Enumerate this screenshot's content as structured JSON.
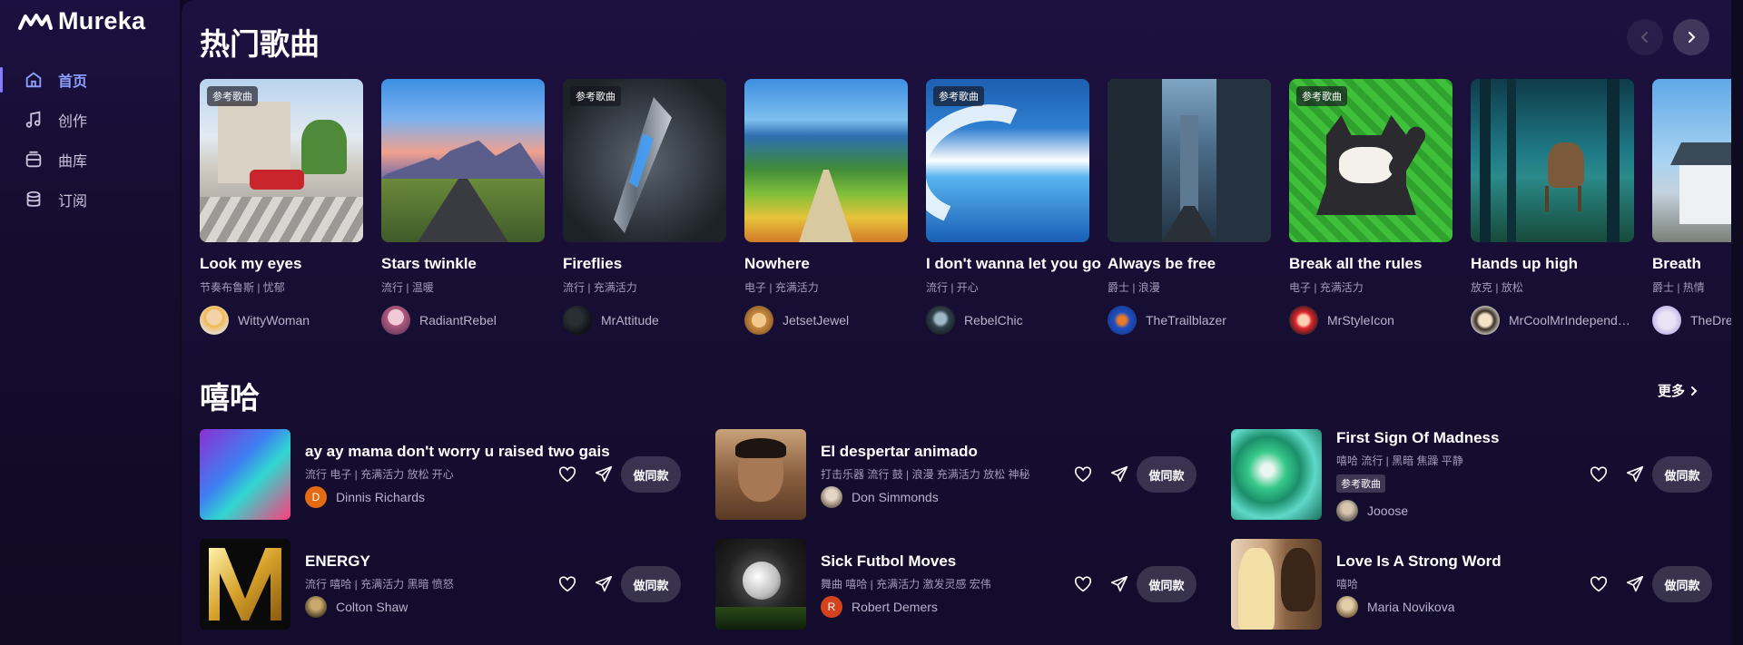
{
  "app": {
    "name": "Mureka"
  },
  "nav": [
    {
      "label": "首页",
      "icon": "home-icon",
      "active": true
    },
    {
      "label": "创作",
      "icon": "music-note-icon",
      "active": false
    },
    {
      "label": "曲库",
      "icon": "library-icon",
      "active": false
    },
    {
      "label": "订阅",
      "icon": "subscription-icon",
      "active": false
    }
  ],
  "trending": {
    "title": "热门歌曲",
    "cards": [
      {
        "title": "Look my eyes",
        "tags": "节奏布鲁斯 | 忧郁",
        "user": "WittyWoman",
        "badge": "参考歌曲",
        "art": "street-scene"
      },
      {
        "title": "Stars twinkle",
        "tags": "流行 | 温暖",
        "user": "RadiantRebel",
        "badge": "",
        "art": "mountain-road"
      },
      {
        "title": "Fireflies",
        "tags": "流行 | 充满活力",
        "user": "MrAttitude",
        "badge": "参考歌曲",
        "art": "spaceship"
      },
      {
        "title": "Nowhere",
        "tags": "电子 | 充满活力",
        "user": "JetsetJewel",
        "badge": "",
        "art": "green-valley"
      },
      {
        "title": "I don't wanna let you go",
        "tags": "流行 | 开心",
        "user": "RebelChic",
        "badge": "参考歌曲",
        "art": "great-wave"
      },
      {
        "title": "Always be free",
        "tags": "爵士 | 浪漫",
        "user": "TheTrailblazer",
        "badge": "",
        "art": "city-street"
      },
      {
        "title": "Break all the rules",
        "tags": "电子 | 充满活力",
        "user": "MrStyleIcon",
        "badge": "参考歌曲",
        "art": "pixel-cat"
      },
      {
        "title": "Hands up high",
        "tags": "放克 | 放松",
        "user": "MrCoolMrIndependent",
        "badge": "",
        "art": "forest-deer"
      },
      {
        "title": "Breath",
        "tags": "爵士 | 热情",
        "user": "TheDreamer",
        "badge": "",
        "art": "house"
      }
    ]
  },
  "hiphop": {
    "title": "嘻哈",
    "more_label": "更多",
    "copy_label": "做同款",
    "rows": [
      {
        "title": "ay ay mama don't worry u raised two gais",
        "tags": "流行 电子 | 充满活力 放松 开心",
        "user": "Dinnis Richards",
        "avatar_letter": "D",
        "badge": ""
      },
      {
        "title": "El despertar animado",
        "tags": "打击乐器 流行 鼓 | 浪漫 充满活力 放松 神秘",
        "user": "Don Simmonds",
        "avatar_letter": "",
        "badge": ""
      },
      {
        "title": "First Sign Of Madness",
        "tags": "嘻哈 流行 | 黑暗 焦躁 平静",
        "user": "Jooose",
        "avatar_letter": "",
        "badge": "参考歌曲"
      },
      {
        "title": "ENERGY",
        "tags": "流行 嘻哈 | 充满活力 黑暗 愤怒",
        "user": "Colton Shaw",
        "avatar_letter": "",
        "badge": ""
      },
      {
        "title": "Sick Futbol Moves",
        "tags": "舞曲 嘻哈 | 充满活力 激发灵感 宏伟",
        "user": "Robert Demers",
        "avatar_letter": "R",
        "badge": ""
      },
      {
        "title": "Love Is A Strong Word",
        "tags": "嘻哈",
        "user": "Maria Novikova",
        "avatar_letter": "",
        "badge": ""
      }
    ]
  },
  "colors": {
    "accent": "#8ea1ff",
    "background": "#0e0a1f"
  }
}
